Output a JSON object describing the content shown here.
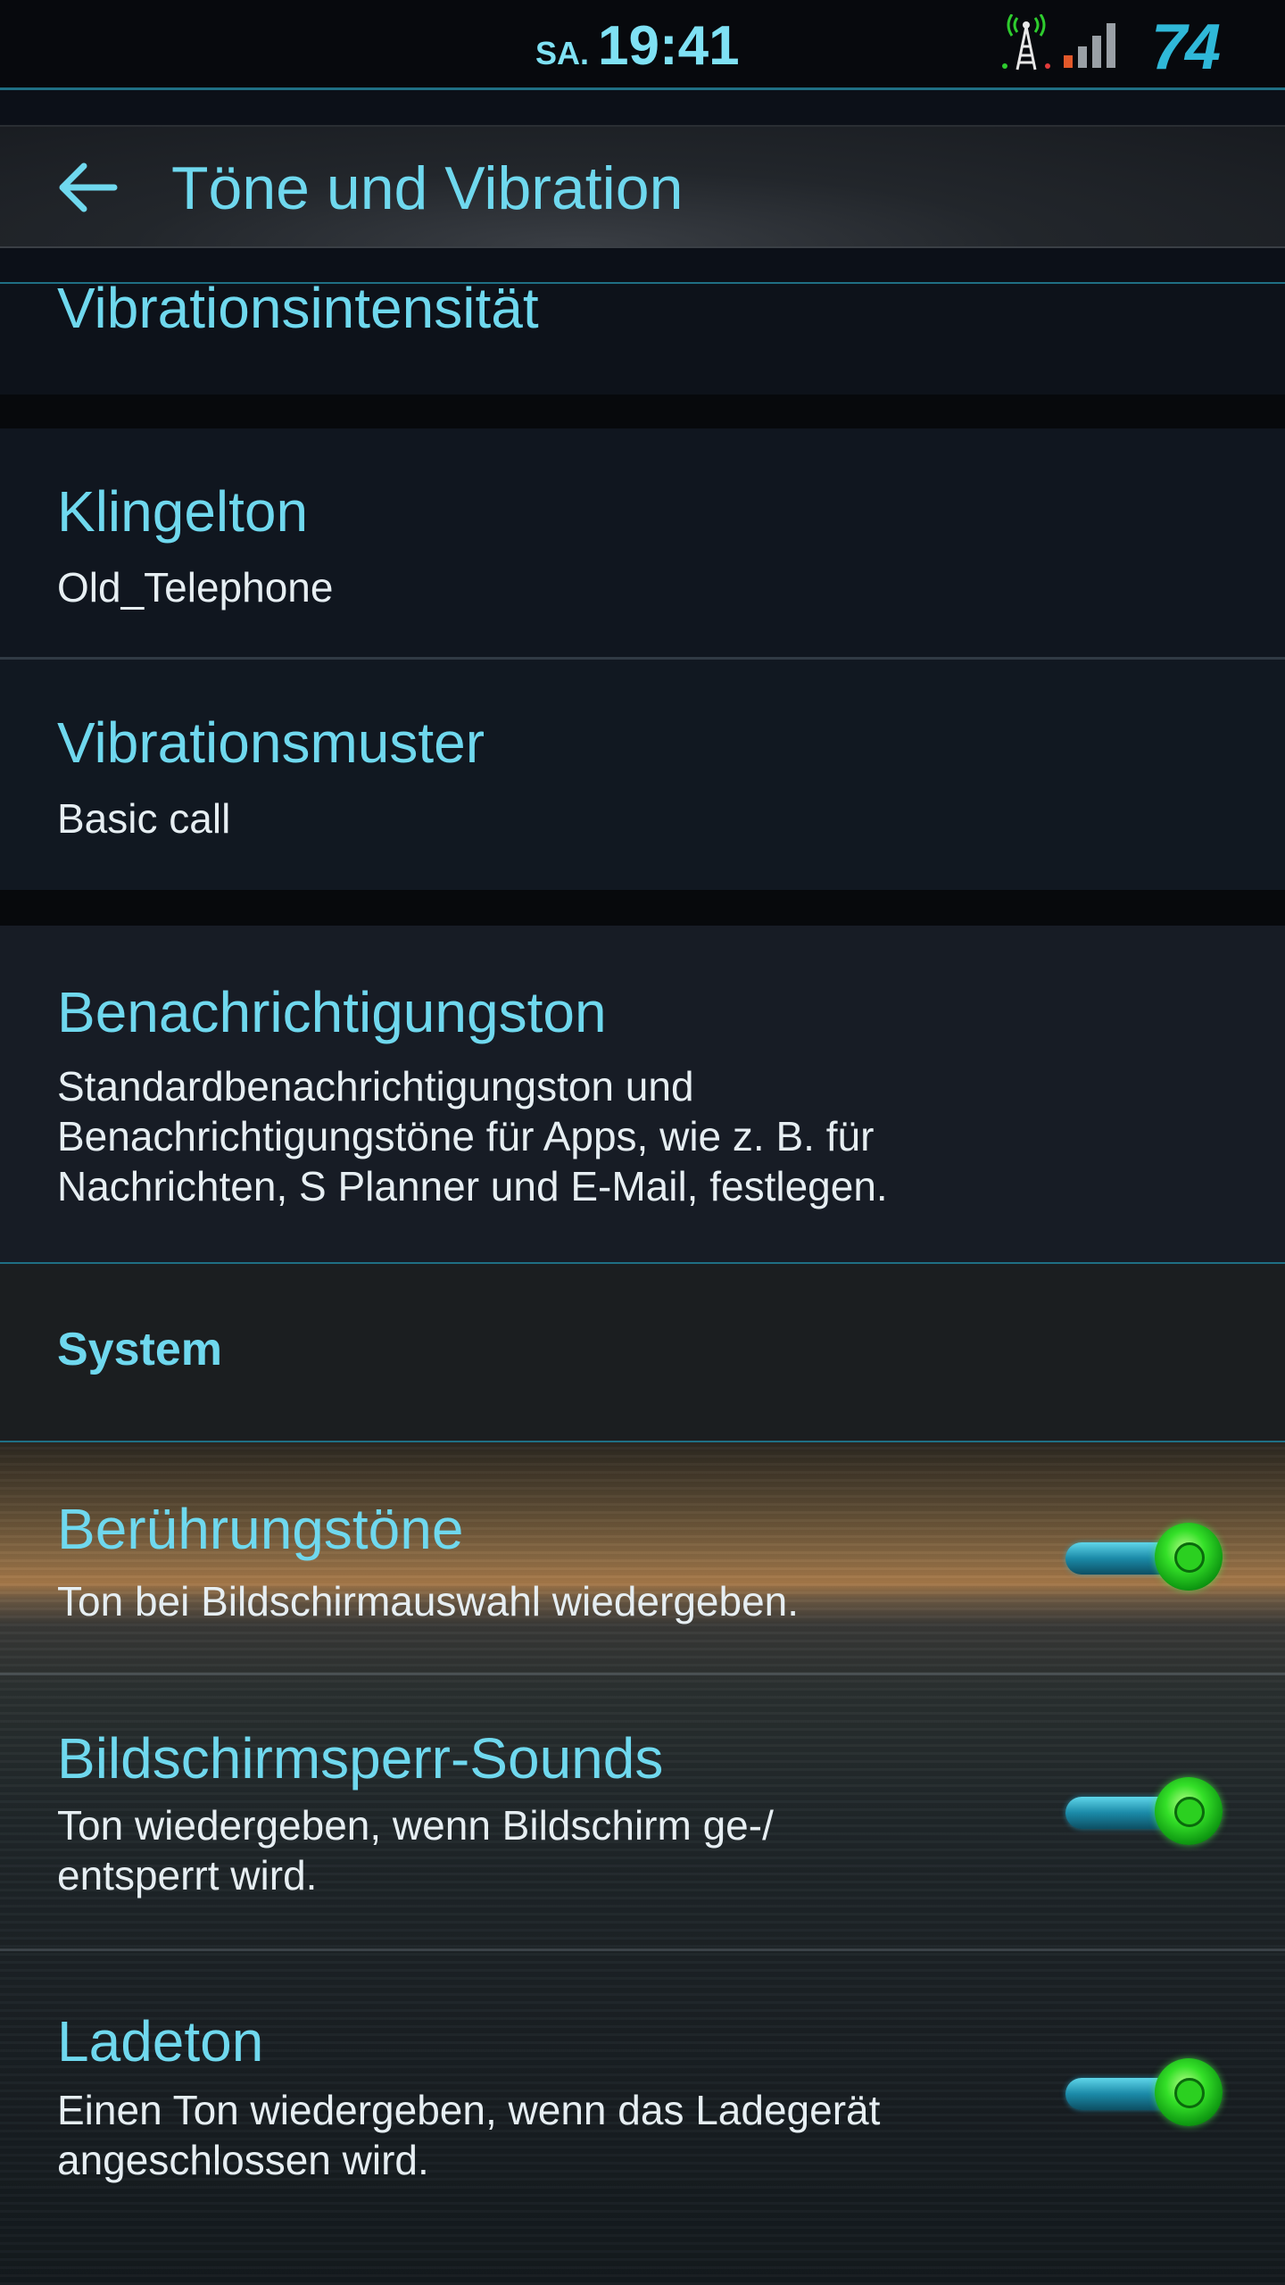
{
  "status_bar": {
    "day": "SA.",
    "time": "19:41",
    "battery": "74"
  },
  "app_bar": {
    "title": "Töne und Vibration"
  },
  "items": {
    "vibration_intensity": {
      "title": "Vibrationsintensität"
    },
    "ringtone": {
      "title": "Klingelton",
      "value": "Old_Telephone"
    },
    "vibration_pattern": {
      "title": "Vibrationsmuster",
      "value": "Basic call"
    },
    "notification_sound": {
      "title": "Benachrichtigungston",
      "description_lines": [
        "Standardbenachrichtigungston und",
        "Benachrichtigungstöne für Apps, wie z. B. für",
        "Nachrichten, S Planner und E-Mail, festlegen."
      ]
    }
  },
  "system_section": {
    "header": "System",
    "items": [
      {
        "title": "Berührungstöne",
        "description_lines": [
          "Ton bei Bildschirmauswahl wiedergeben."
        ],
        "enabled": true
      },
      {
        "title": "Bildschirmsperr-Sounds",
        "description_lines": [
          "Ton wiedergeben, wenn Bildschirm ge-/",
          "entsperrt wird."
        ],
        "enabled": true
      },
      {
        "title": "Ladeton",
        "description_lines": [
          "Einen Ton wiedergeben, wenn das Ladegerät",
          "angeschlossen wird."
        ],
        "enabled": true
      }
    ]
  },
  "colors": {
    "accent": "#6fd8ee",
    "toggle_on": "#34e028"
  }
}
